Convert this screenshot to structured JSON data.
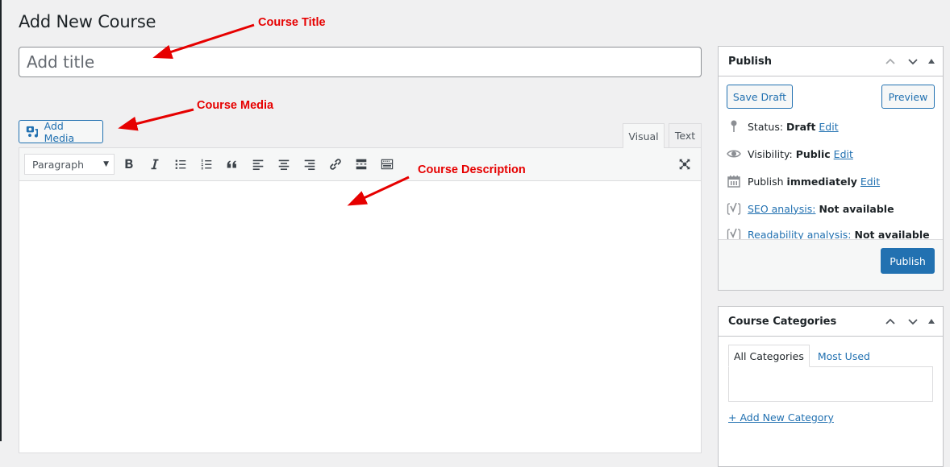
{
  "page": {
    "title": "Add New Course"
  },
  "title_field": {
    "placeholder": "Add title",
    "value": ""
  },
  "media": {
    "add_media_label": "Add Media"
  },
  "editor": {
    "tabs": [
      {
        "label": "Visual",
        "active": true
      },
      {
        "label": "Text",
        "active": false
      }
    ],
    "format_select": "Paragraph",
    "toolbar_icons": [
      "bold-icon",
      "italic-icon",
      "bulleted-list-icon",
      "numbered-list-icon",
      "blockquote-icon",
      "align-left-icon",
      "align-center-icon",
      "align-right-icon",
      "link-icon",
      "read-more-icon",
      "toolbar-toggle-icon",
      "fullscreen-icon"
    ],
    "content": ""
  },
  "annotations": {
    "title": "Course Title",
    "media": "Course Media",
    "description": "Course Description",
    "color": "#e60000"
  },
  "publish_box": {
    "title": "Publish",
    "save_draft": "Save Draft",
    "preview": "Preview",
    "status_label": "Status:",
    "status_value": "Draft",
    "visibility_label": "Visibility:",
    "visibility_value": "Public",
    "publish_label": "Publish",
    "publish_value": "immediately",
    "edit_label": "Edit",
    "seo_label": "SEO analysis:",
    "seo_value": "Not available",
    "readability_label": "Readability analysis:",
    "readability_value": "Not available",
    "publish_button": "Publish"
  },
  "categories_box": {
    "title": "Course Categories",
    "tabs": [
      {
        "label": "All Categories",
        "active": true
      },
      {
        "label": "Most Used",
        "active": false
      }
    ],
    "add_new": "+ Add New Category"
  },
  "colors": {
    "accent": "#2271b1",
    "background": "#f0f0f1",
    "annotation": "#e60000"
  }
}
